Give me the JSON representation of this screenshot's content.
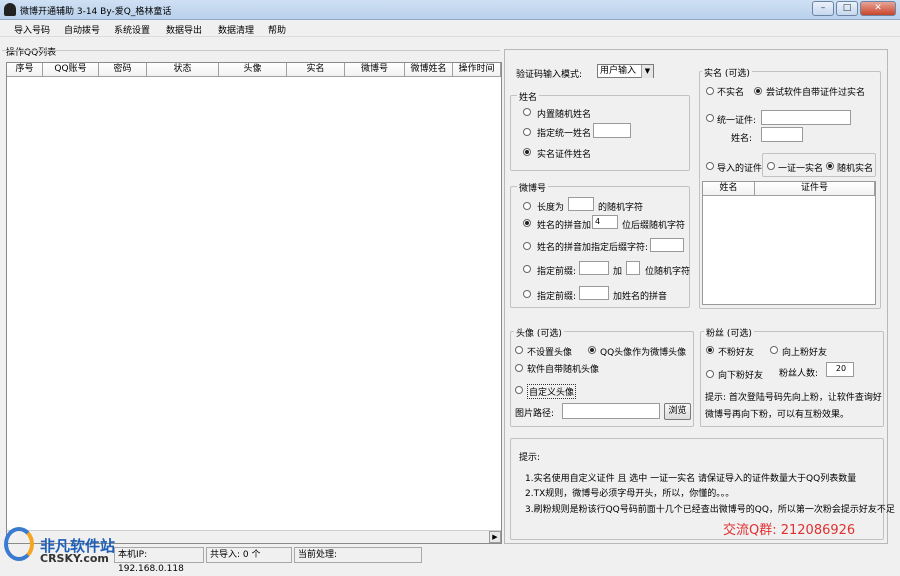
{
  "window": {
    "title": "微博开通辅助 3-14 By-爱Q_格林童话",
    "controls": {
      "min": "–",
      "max": "□",
      "close": "✕"
    }
  },
  "menu": [
    "导入号码",
    "自动拨号",
    "系统设置",
    "数据导出",
    "数据清理",
    "帮助"
  ],
  "list": {
    "group": "操作QQ列表",
    "columns": [
      "序号",
      "QQ账号",
      "密码",
      "状态",
      "头像",
      "实名",
      "微博号",
      "微博姓名",
      "操作时间"
    ]
  },
  "status": {
    "ip": "本机IP: 192.168.0.118",
    "imported": "共导入: 0 个",
    "current": "当前处理:"
  },
  "captcha": {
    "label": "验证码输入模式:",
    "value": "用户输入"
  },
  "name": {
    "group": "姓名",
    "opt1": "内置随机姓名",
    "opt2": "指定统一姓名",
    "opt3": "实名证件姓名",
    "opt2_value": "",
    "selected": 3
  },
  "weibo": {
    "group": "微博号",
    "o1a": "长度为",
    "o1b": "的随机字符",
    "o2a": "姓名的拼音加",
    "o2_value": "4",
    "o2b": "位后缀随机字符",
    "o3": "姓名的拼音加指定后缀字符:",
    "o4a": "指定前缀:",
    "o4b": "加",
    "o4c": "位随机字符",
    "o5a": "指定前缀:",
    "o5b": "加姓名的拼音"
  },
  "realname": {
    "group": "实名 (可选)",
    "opt1": "不实名",
    "opt2": "尝试软件自带证件过实名",
    "opt3": "统一证件:",
    "name_label": "姓名:",
    "opt4": "导入的证件",
    "sub1": "一证一实名",
    "sub2": "随机实名",
    "cols": [
      "姓名",
      "证件号"
    ]
  },
  "avatar": {
    "group": "头像 (可选)",
    "opt1": "不设置头像",
    "opt2": "QQ头像作为微博头像",
    "opt3": "软件自带随机头像",
    "opt4": "自定义头像",
    "path_label": "图片路径:",
    "browse": "浏览"
  },
  "fans": {
    "group": "粉丝 (可选)",
    "opt1": "不粉好友",
    "opt2": "向上粉好友",
    "opt3": "向下粉好友",
    "count_label": "粉丝人数:",
    "count": "20",
    "hint1": "提示: 首次登陆号码先向上粉，让软件查询好",
    "hint2": "微博号再向下粉，可以有互粉效果。"
  },
  "tips": {
    "title": "提示:",
    "t1": "1.实名使用自定义证件 且 选中 一证一实名 请保证导入的证件数量大于QQ列表数量",
    "t2": "2.TX规则，微博号必须字母开头，所以，你懂的。。。",
    "t3": "3.刷粉规则是粉该行QQ号码前面十几个已经查出微博号的QQ，所以第一次粉会提示好友不足"
  },
  "qqgroup": "交流Q群: 212086926",
  "watermark": {
    "cn": "非凡软件站",
    "en": "CRSKY.com"
  }
}
